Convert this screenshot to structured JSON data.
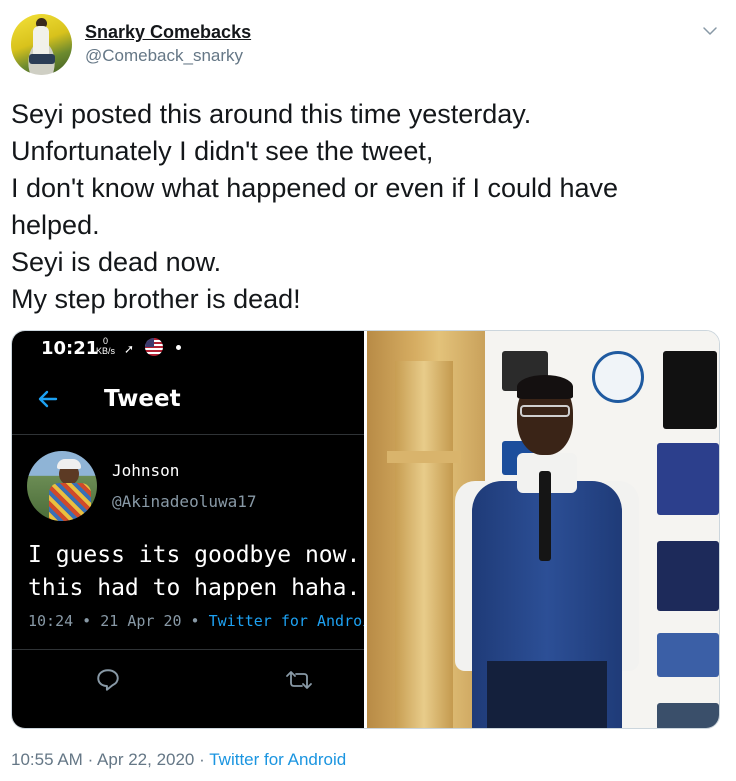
{
  "author": {
    "name": "Snarky Comebacks",
    "handle": "@Comeback_snarky"
  },
  "tweet": {
    "lines": [
      "Seyi posted this around this time yesterday.",
      "Unfortunately I didn't see the tweet,",
      "I don't know what happened or even if I could have",
      "helped.",
      "Seyi is dead now.",
      "My step brother is dead!"
    ],
    "time": "10:55 AM",
    "date": "Apr 22, 2020",
    "separator": "·",
    "source": "Twitter for Android"
  },
  "screenshot": {
    "status_time": "10:21",
    "speed_value": "0",
    "speed_unit": "KB/s",
    "screen_title": "Tweet",
    "user_name": "Johnson",
    "user_handle": "@Akinadeoluwa17",
    "body_lines": [
      "I guess its goodbye now...no c",
      "this had to happen haha...bye"
    ],
    "meta_time": "10:24 • 21 Apr 20 • ",
    "meta_source": "Twitter for Android"
  },
  "icons": {
    "menu": "chevron-down-icon",
    "back": "arrow-left-icon",
    "reply": "reply-icon",
    "retweet": "retweet-icon"
  },
  "colors": {
    "link": "#1b95e0",
    "muted": "#657786",
    "twitter_blue": "#1da1f2"
  }
}
